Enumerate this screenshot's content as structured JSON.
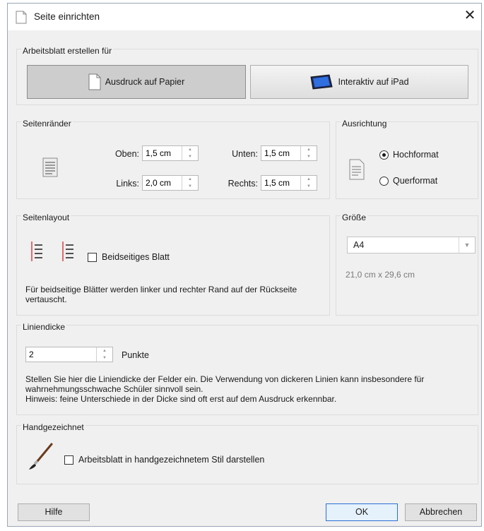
{
  "window": {
    "title": "Seite einrichten",
    "close_glyph": "✕"
  },
  "worksheet": {
    "title": "Arbeitsblatt erstellen für",
    "paper_label": "Ausdruck auf Papier",
    "ipad_label": "Interaktiv auf iPad",
    "selected": "paper"
  },
  "margins": {
    "title": "Seitenränder",
    "top_label": "Oben:",
    "top_value": "1,5 cm",
    "bottom_label": "Unten:",
    "bottom_value": "1,5 cm",
    "left_label": "Links:",
    "left_value": "2,0 cm",
    "right_label": "Rechts:",
    "right_value": "1,5 cm"
  },
  "orientation": {
    "title": "Ausrichtung",
    "portrait_label": "Hochformat",
    "landscape_label": "Querformat",
    "selected": "portrait"
  },
  "layout": {
    "title": "Seitenlayout",
    "double_sided_label": "Beidseitiges Blatt",
    "double_sided_checked": false,
    "note": "Für beidseitige Blätter werden linker und rechter Rand auf der Rückseite vertauscht."
  },
  "size": {
    "title": "Größe",
    "value": "A4",
    "dimensions": "21,0 cm x 29,6 cm"
  },
  "line_width": {
    "title": "Liniendicke",
    "value": "2",
    "unit": "Punkte",
    "description": "Stellen Sie hier die Liniendicke der Felder ein. Die Verwendung von dickeren Linien kann insbesondere für wahrnehmungsschwache Schüler sinnvoll sein.",
    "hint": "Hinweis: feine Unterschiede in der Dicke sind oft erst auf dem Ausdruck erkennbar."
  },
  "hand_drawn": {
    "title": "Handgezeichnet",
    "label": "Arbeitsblatt in handgezeichnetem Stil darstellen",
    "checked": false
  },
  "buttons": {
    "help": "Hilfe",
    "ok": "OK",
    "cancel": "Abbrechen"
  }
}
